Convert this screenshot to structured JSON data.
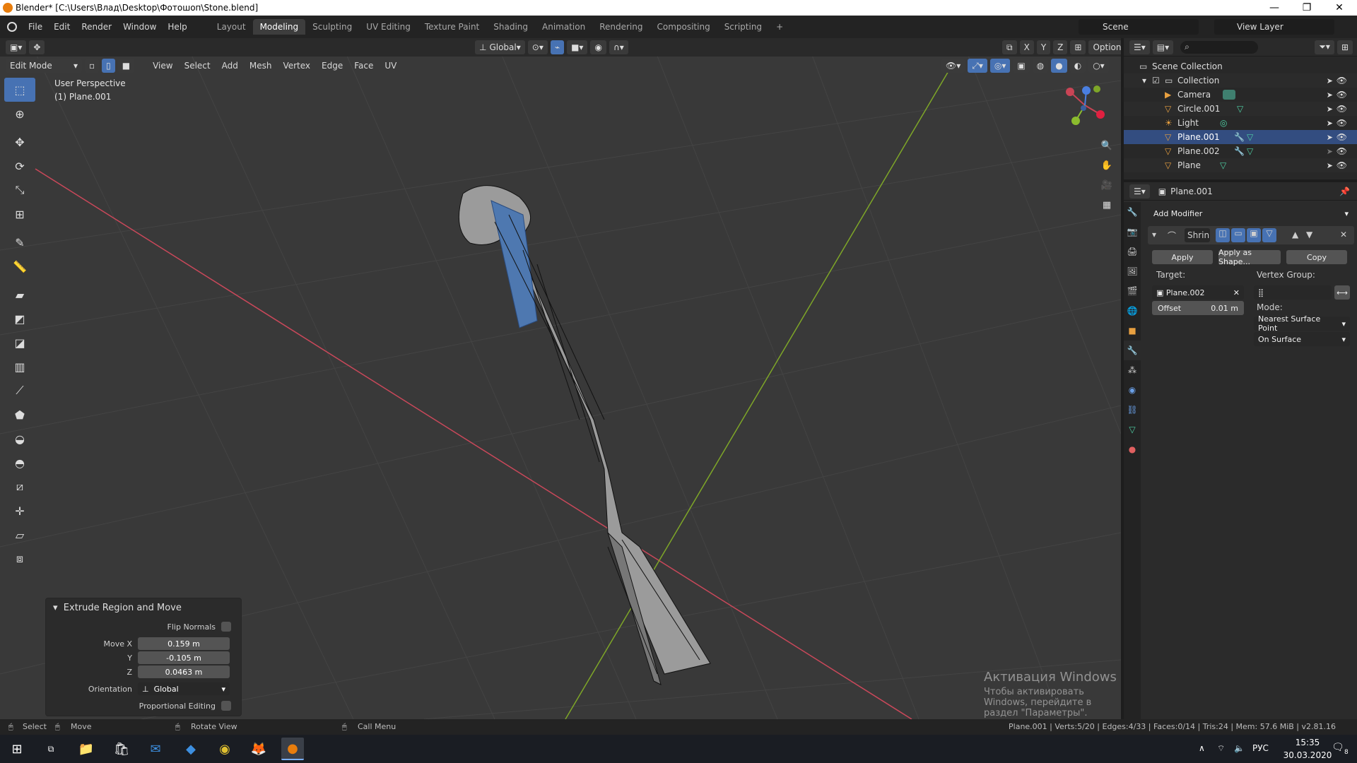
{
  "titlebar": {
    "title": "Blender* [C:\\Users\\Влад\\Desktop\\Фотошоп\\Stone.blend]",
    "minimize": "—",
    "maximize": "❐",
    "close": "✕"
  },
  "menu": {
    "items": [
      "File",
      "Edit",
      "Render",
      "Window",
      "Help"
    ]
  },
  "workspaces": [
    "Layout",
    "Modeling",
    "Sculpting",
    "UV Editing",
    "Texture Paint",
    "Shading",
    "Animation",
    "Rendering",
    "Compositing",
    "Scripting"
  ],
  "workspace_add": "+",
  "scene": {
    "label": "Scene",
    "view_layer": "View Layer"
  },
  "viewport_header": {
    "mode": "Edit Mode",
    "menus": [
      "View",
      "Select",
      "Add",
      "Mesh",
      "Vertex",
      "Edge",
      "Face",
      "UV"
    ],
    "orientation": "Global",
    "axes": [
      "X",
      "Y",
      "Z"
    ],
    "options": "Options"
  },
  "viewport": {
    "perspective": "User Perspective",
    "object": "(1) Plane.001"
  },
  "gizmo": {
    "x": "X",
    "y": "Y",
    "z": "Z"
  },
  "operator_panel": {
    "title": "Extrude Region and Move",
    "flip_normals": "Flip Normals",
    "move_x_label": "Move X",
    "move_x": "0.159 m",
    "y_label": "Y",
    "y": "-0.105 m",
    "z_label": "Z",
    "z": "0.0463 m",
    "orientation_label": "Orientation",
    "orientation": "Global",
    "proportional": "Proportional Editing"
  },
  "outliner": {
    "root": "Scene Collection",
    "collection": "Collection",
    "items": [
      "Camera",
      "Circle.001",
      "Light",
      "Plane.001",
      "Plane.002",
      "Plane"
    ]
  },
  "properties": {
    "object": "Plane.001",
    "add_modifier": "Add Modifier",
    "modifier_name": "Shrin",
    "apply": "Apply",
    "apply_shape": "Apply as Shape...",
    "copy": "Copy",
    "target_label": "Target:",
    "target": "Plane.002",
    "vertex_group_label": "Vertex Group:",
    "offset_label": "Offset",
    "offset": "0.01 m",
    "mode_label": "Mode:",
    "mode": "Nearest Surface Point",
    "on_surface": "On Surface"
  },
  "statusbar": {
    "select": "Select",
    "move": "Move",
    "rotate": "Rotate View",
    "call_menu": "Call Menu",
    "stats": "Plane.001 | Verts:5/20 | Edges:4/33 | Faces:0/14 | Tris:24 | Mem: 57.6 MiB | v2.81.16"
  },
  "watermark": {
    "line1": "Активация Windows",
    "line2": "Чтобы активировать Windows, перейдите в раздел \"Параметры\"."
  },
  "taskbar": {
    "lang": "РУС",
    "time": "15:35",
    "date": "30.03.2020",
    "notif": "8"
  },
  "colors": {
    "accent": "#4772b3",
    "x_axis": "#d6455a",
    "y_axis": "#8bbc2e",
    "orange": "#e87d0d"
  }
}
